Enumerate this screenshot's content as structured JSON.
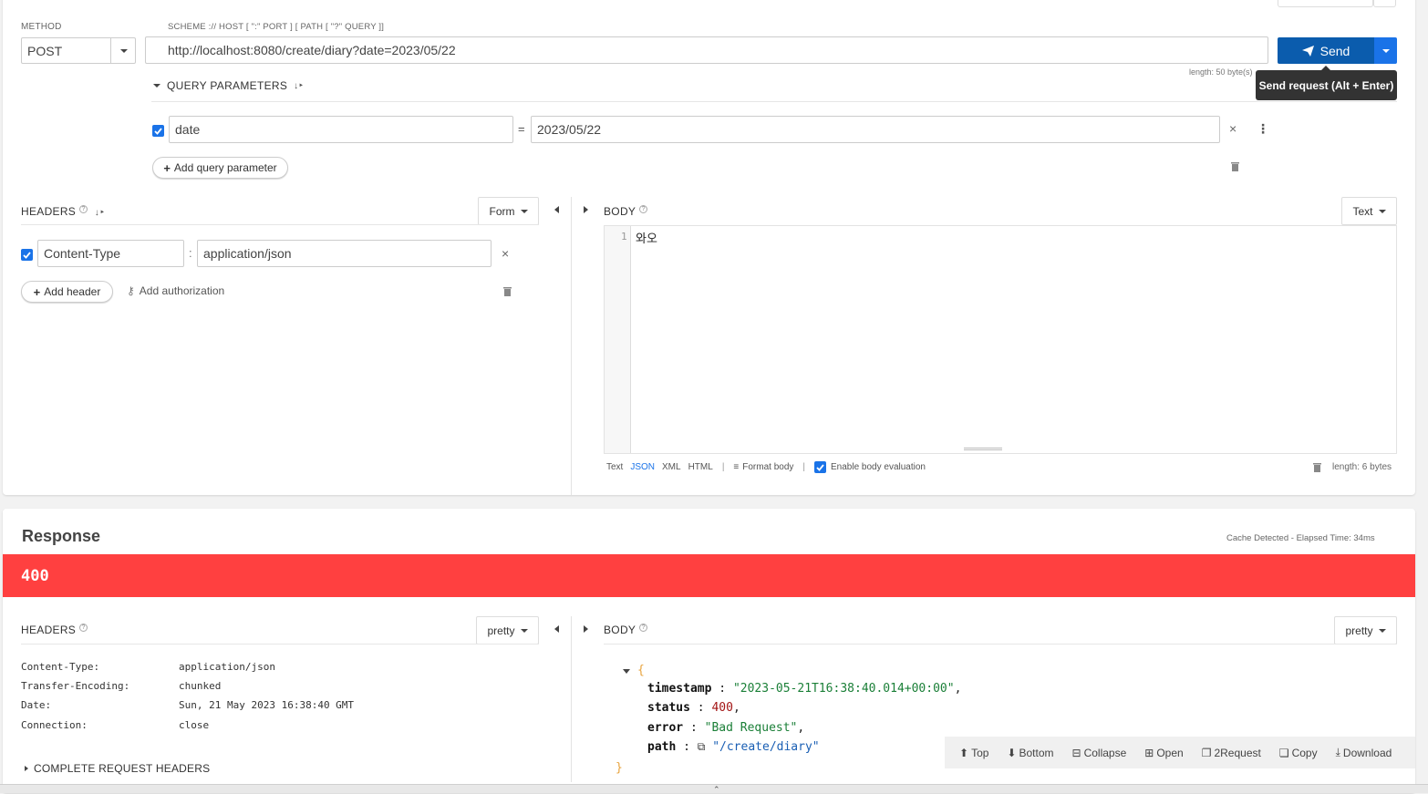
{
  "request": {
    "method_label": "METHOD",
    "method_value": "POST",
    "url_hint": "SCHEME :// HOST [ \":\" PORT ] [ PATH [ \"?\" QUERY ]]",
    "url_value": "http://localhost:8080/create/diary?date=2023/05/22",
    "length_note": "length: 50 byte(s)",
    "send_label": "Send",
    "send_tooltip": "Send request (Alt + Enter)",
    "query_title": "QUERY PARAMETERS",
    "query_params": [
      {
        "name": "date",
        "sep": "=",
        "value": "2023/05/22"
      }
    ],
    "add_query_label": "Add query parameter",
    "headers_title": "HEADERS",
    "headers_mode": "Form",
    "headers": [
      {
        "name": "Content-Type",
        "sep": ":",
        "value": "application/json"
      }
    ],
    "add_header_label": "Add header",
    "add_auth_label": "Add authorization",
    "body_title": "BODY",
    "body_mode": "Text",
    "body_line_no": "1",
    "body_text": "와오",
    "body_formats": {
      "text": "Text",
      "json": "JSON",
      "xml": "XML",
      "html": "HTML"
    },
    "format_body_label": "Format body",
    "enable_eval_label": "Enable body evaluation",
    "body_length": "length: 6 bytes"
  },
  "response": {
    "title": "Response",
    "cache_note": "Cache Detected - Elapsed Time: 34ms",
    "status_code": "400",
    "status_color": "#ff4040",
    "headers_title": "HEADERS",
    "headers_mode": "pretty",
    "headers": [
      {
        "name": "Content-Type:",
        "value": "application/json"
      },
      {
        "name": "Transfer-Encoding:",
        "value": "chunked"
      },
      {
        "name": "Date:",
        "value": "Sun, 21 May 2023 16:38:40 GMT"
      },
      {
        "name": "Connection:",
        "value": "close"
      }
    ],
    "complete_headers_label": "COMPLETE REQUEST HEADERS",
    "body_title": "BODY",
    "body_mode": "pretty",
    "json": {
      "open": "{",
      "close": "}",
      "timestamp_key": "timestamp",
      "timestamp_val": "\"2023-05-21T16:38:40.014+00:00\"",
      "status_key": "status",
      "status_val": "400",
      "error_key": "error",
      "error_val": "\"Bad Request\"",
      "path_key": "path",
      "path_val": "\"/create/diary\""
    },
    "toolbar": {
      "top": "Top",
      "bottom": "Bottom",
      "collapse": "Collapse",
      "open": "Open",
      "to_request": "2Request",
      "copy": "Copy",
      "download": "Download"
    }
  },
  "colors": {
    "accent": "#1a73e8",
    "send": "#0b5cad",
    "error": "#ff4040"
  }
}
